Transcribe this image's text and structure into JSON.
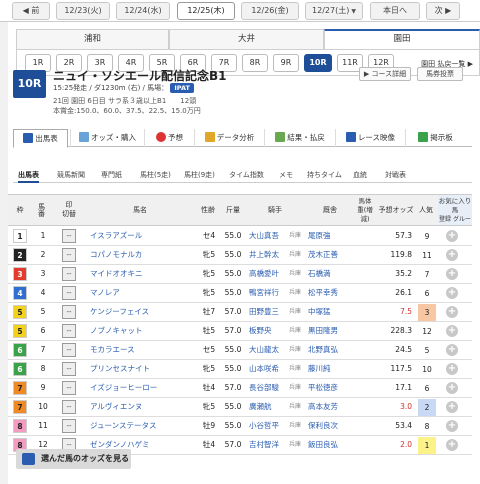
{
  "dates": {
    "prev": "前",
    "next": "次",
    "items": [
      "12/23(火)",
      "12/24(水)",
      "12/25(木)",
      "12/26(金)",
      "12/27(土)",
      "本日へ"
    ]
  },
  "venues": [
    "浦和",
    "大井",
    "園田"
  ],
  "races": [
    "1R",
    "2R",
    "3R",
    "4R",
    "5R",
    "6R",
    "7R",
    "8R",
    "9R",
    "10R",
    "11R",
    "12R"
  ],
  "venue_link": "園田 払戻一覧 ▶",
  "race": {
    "number": "10R",
    "name": "ニュイ・ソシエール配信記念B1",
    "info1": "15:25発走 / ダ1230m (右) / 馬場：",
    "ipat": "IPAT",
    "info2": "21回 園田 6日目 サラ系３歳以上B1　　12頭",
    "info3": "本賞金:150.0、60.0、37.5、22.5、15.0万円",
    "btn_course": "コース詳細",
    "btn_vote": "馬券投票"
  },
  "tabs": [
    "出馬表",
    "オッズ・購入",
    "予想",
    "データ分析",
    "結果・払戻",
    "レース映像",
    "掲示板"
  ],
  "subtabs": [
    "出馬表",
    "競馬新聞",
    "専門紙",
    "馬柱(5走)",
    "馬柱(9走)",
    "タイム指数",
    "メモ",
    "持ちタイム",
    "血統",
    "対戦表"
  ],
  "header": {
    "waku": "枠",
    "umaban": "馬番",
    "mark": "印",
    "mark_sub": "切替",
    "name": "馬名",
    "sexage": "性齢",
    "kinryo": "斤量",
    "jockey": "騎手",
    "trainer": "厩舎",
    "weight": "馬体重(増減)",
    "odds": "予想オッズ",
    "pop": "人気",
    "fav": "お気に入り馬",
    "fav_sub1": "登録",
    "fav_sub2": "グルー"
  },
  "entries": [
    {
      "waku": "1",
      "num": "1",
      "mark": "--",
      "name": "イスラアズール",
      "sexage": "セ4",
      "kinryo": "55.0",
      "jockey": "大山真吾",
      "loc": "兵庫",
      "trainer": "尾原強",
      "odds": "57.3",
      "pop": "9"
    },
    {
      "waku": "2",
      "num": "2",
      "mark": "--",
      "name": "コパノモナルカ",
      "sexage": "牝5",
      "kinryo": "55.0",
      "jockey": "井上幹太",
      "loc": "兵庫",
      "trainer": "茂木正善",
      "odds": "119.8",
      "pop": "11"
    },
    {
      "waku": "3",
      "num": "3",
      "mark": "--",
      "name": "マイドオオキニ",
      "sexage": "牝5",
      "kinryo": "55.0",
      "jockey": "高橋愛叶",
      "loc": "兵庫",
      "trainer": "石橋満",
      "odds": "35.2",
      "pop": "7"
    },
    {
      "waku": "4",
      "num": "4",
      "mark": "--",
      "name": "マノレア",
      "sexage": "牝5",
      "kinryo": "55.0",
      "jockey": "鴨宮祥行",
      "loc": "兵庫",
      "trainer": "松平幸秀",
      "odds": "26.1",
      "pop": "6"
    },
    {
      "waku": "5",
      "num": "5",
      "mark": "--",
      "name": "ケンジーフェイス",
      "sexage": "牡7",
      "kinryo": "57.0",
      "jockey": "田野豊三",
      "loc": "兵庫",
      "trainer": "中塚猛",
      "odds": "7.5",
      "pop": "3"
    },
    {
      "waku": "5",
      "num": "6",
      "mark": "--",
      "name": "ノブノキャット",
      "sexage": "牡5",
      "kinryo": "57.0",
      "jockey": "板野央",
      "loc": "兵庫",
      "trainer": "黒田隆男",
      "odds": "228.3",
      "pop": "12"
    },
    {
      "waku": "6",
      "num": "7",
      "mark": "--",
      "name": "モカラエース",
      "sexage": "セ5",
      "kinryo": "55.0",
      "jockey": "大山龍太",
      "loc": "兵庫",
      "trainer": "北野真弘",
      "odds": "24.5",
      "pop": "5"
    },
    {
      "waku": "6",
      "num": "8",
      "mark": "--",
      "name": "プリンセスナイト",
      "sexage": "牝5",
      "kinryo": "55.0",
      "jockey": "山本咲希",
      "loc": "兵庫",
      "trainer": "藤川純",
      "odds": "117.5",
      "pop": "10"
    },
    {
      "waku": "7",
      "num": "9",
      "mark": "--",
      "name": "イズジョーヒーロー",
      "sexage": "牡4",
      "kinryo": "57.0",
      "jockey": "長谷部駿",
      "loc": "兵庫",
      "trainer": "平松徳彦",
      "odds": "17.1",
      "pop": "6"
    },
    {
      "waku": "7",
      "num": "10",
      "mark": "--",
      "name": "アルヴィエンヌ",
      "sexage": "牝5",
      "kinryo": "55.0",
      "jockey": "廣瀬航",
      "loc": "兵庫",
      "trainer": "高本友芳",
      "odds": "3.0",
      "pop": "2"
    },
    {
      "waku": "8",
      "num": "11",
      "mark": "--",
      "name": "ジューンステータス",
      "sexage": "牡9",
      "kinryo": "55.0",
      "jockey": "小谷哲平",
      "loc": "兵庫",
      "trainer": "保利良次",
      "odds": "53.4",
      "pop": "8"
    },
    {
      "waku": "8",
      "num": "12",
      "mark": "--",
      "name": "ゼンダンノハゲミ",
      "sexage": "牡4",
      "kinryo": "57.0",
      "jockey": "吉村智洋",
      "loc": "兵庫",
      "trainer": "飯田良弘",
      "odds": "2.0",
      "pop": "1"
    }
  ],
  "bottom_button": "選んだ馬のオッズを見る",
  "colors": {
    "accent": "#1f4e98",
    "waku": {
      "1": "#ffffff",
      "2": "#222222",
      "3": "#e23b2e",
      "4": "#2f6fd1",
      "5": "#f3d21b",
      "6": "#3aa34a",
      "7": "#f08a24",
      "8": "#f49bc1"
    },
    "pop1": "#fbf28a",
    "pop2": "#c9d8f4",
    "pop3": "#f7c7a3",
    "odds_low": "#d0312d"
  }
}
